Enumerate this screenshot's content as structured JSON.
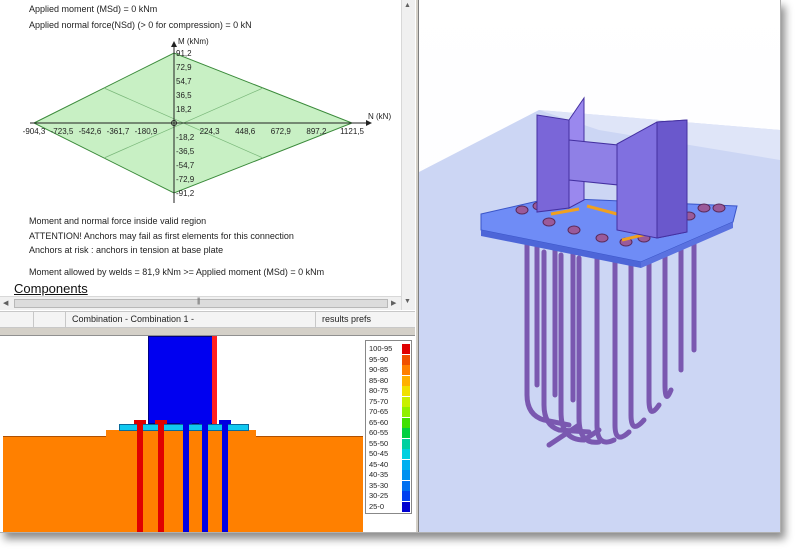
{
  "report": {
    "applied_moment": "Applied moment (MSd) = 0 kNm",
    "applied_normal_force": "Applied normal force(NSd) (> 0 for compression) = 0 kN",
    "valid_region": "Moment and normal force inside valid region",
    "attention": "ATTENTION! Anchors may fail as first elements for this connection",
    "anchors_at_risk": "Anchors at risk : anchors in tension at base plate",
    "welds": "Moment allowed by welds = 81,9 kNm >= Applied moment (MSd) = 0 kNm",
    "components_heading": "Components"
  },
  "chart_data": {
    "type": "area",
    "title": "",
    "xlabel": "N (kN)",
    "ylabel": "M (kNm)",
    "xlim": [
      -904.3,
      1121.5
    ],
    "ylim": [
      -91.2,
      91.2
    ],
    "x_ticks": [
      "-904,3",
      "-723,5",
      "-542,6",
      "-361,7",
      "-180,9",
      "224,3",
      "448,6",
      "672,9",
      "897,2",
      "1121,5"
    ],
    "y_ticks": [
      "91,2",
      "72,9",
      "54,7",
      "36,5",
      "18,2",
      "-18,2",
      "-36,5",
      "-54,7",
      "-72,9",
      "-91,2"
    ],
    "x": [
      -904.3,
      0,
      1121.5,
      0,
      -904.3
    ],
    "y": [
      0,
      91.2,
      0,
      -91.2,
      0
    ],
    "applied_point": [
      0,
      0
    ],
    "fill_color": "#c8f0c4",
    "line_color": "#3a8a3a"
  },
  "toolbar": {
    "combination": "Combination - Combination 1 -",
    "results_prefs": "results prefs"
  },
  "legend": {
    "labels": [
      "100-95",
      "95-90",
      "90-85",
      "85-80",
      "80-75",
      "75-70",
      "70-65",
      "65-60",
      "60-55",
      "55-50",
      "50-45",
      "45-40",
      "40-35",
      "35-30",
      "30-25",
      "25-0"
    ],
    "colors": [
      "#e00000",
      "#f05000",
      "#ff8000",
      "#ffb000",
      "#f0e000",
      "#c8f000",
      "#90f000",
      "#40e000",
      "#00d040",
      "#00d0a0",
      "#00d0e0",
      "#00b0f0",
      "#0090f0",
      "#0070f0",
      "#0040f0",
      "#0000d0"
    ]
  },
  "icons": {
    "scroll_up": "▲",
    "scroll_down": "▼",
    "scroll_left": "◀",
    "scroll_right": "▶",
    "grip": "|||"
  }
}
